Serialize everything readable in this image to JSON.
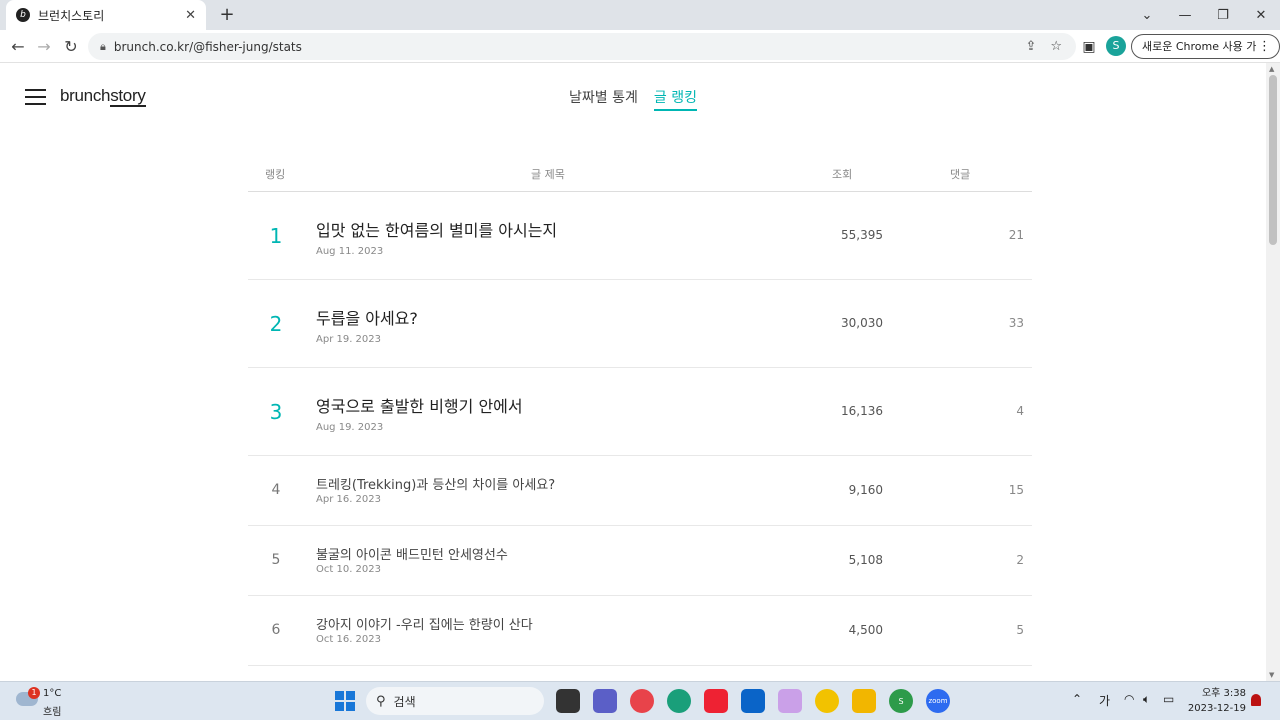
{
  "browser": {
    "tab_title": "브런치스토리",
    "tab_close": "✕",
    "new_tab": "+",
    "url": "brunch.co.kr/@fisher-jung/stats",
    "profile_initial": "S",
    "update_button": "새로운 Chrome 사용 가능",
    "update_menu": "⋮",
    "window": {
      "chevron": "⌄",
      "minimize": "—",
      "maximize": "❐",
      "close": "✕"
    },
    "nav": {
      "back": "←",
      "forward": "→",
      "reload": "↻"
    }
  },
  "site": {
    "logo_part1": "brunch",
    "logo_part2": "story",
    "tabs": [
      {
        "label": "날짜별 통계",
        "active": false
      },
      {
        "label": "글 랭킹",
        "active": true
      }
    ],
    "accent": "#00b6b3"
  },
  "table": {
    "headers": {
      "rank": "랭킹",
      "title": "글 제목",
      "views": "조회",
      "comments": "댓글"
    },
    "rows": [
      {
        "rank": "1",
        "title": "입맛 없는 한여름의 별미를 아시는지",
        "date": "Aug 11. 2023",
        "views": "55,395",
        "comments": "21"
      },
      {
        "rank": "2",
        "title": "두릅을 아세요?",
        "date": "Apr 19. 2023",
        "views": "30,030",
        "comments": "33"
      },
      {
        "rank": "3",
        "title": "영국으로 출발한 비행기 안에서",
        "date": "Aug 19. 2023",
        "views": "16,136",
        "comments": "4"
      },
      {
        "rank": "4",
        "title": "트레킹(Trekking)과 등산의 차이를 아세요?",
        "date": "Apr 16. 2023",
        "views": "9,160",
        "comments": "15"
      },
      {
        "rank": "5",
        "title": "불굴의 아이콘 배드민턴 안세영선수",
        "date": "Oct 10. 2023",
        "views": "5,108",
        "comments": "2"
      },
      {
        "rank": "6",
        "title": "강아지 이야기 -우리 집에는 한량이 산다",
        "date": "Oct 16. 2023",
        "views": "4,500",
        "comments": "5"
      }
    ]
  },
  "taskbar": {
    "weather_temp": "1°C",
    "weather_desc": "흐림",
    "weather_badge": "1",
    "search_label": "검색",
    "ime": "가",
    "time": "오후 3:38",
    "date": "2023-12-19",
    "chrome_badge": "S",
    "zoom_label": "zoom"
  }
}
